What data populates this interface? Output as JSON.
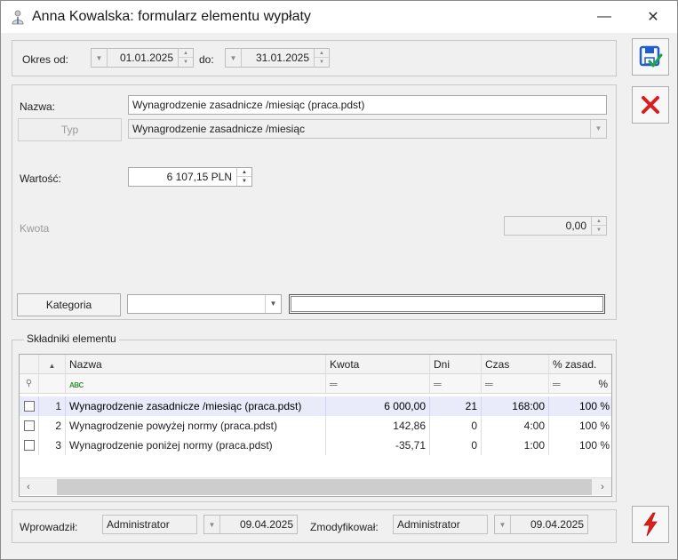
{
  "window": {
    "title": "Anna Kowalska: formularz elementu wypłaty",
    "minimize": "—",
    "close": "✕"
  },
  "period": {
    "from_label": "Okres od:",
    "from_value": "01.01.2025",
    "to_label": "do:",
    "to_value": "31.01.2025"
  },
  "element": {
    "name_label": "Nazwa:",
    "name_value": "Wynagrodzenie zasadnicze /miesiąc (praca.pdst)",
    "type_button": "Typ",
    "type_value": "Wynagrodzenie zasadnicze /miesiąc",
    "value_label": "Wartość:",
    "value_value": "6 107,15 PLN",
    "amount_label": "Kwota",
    "amount_value": "0,00",
    "category_button": "Kategoria",
    "category_value": "",
    "category_desc": ""
  },
  "components": {
    "group_title": "Składniki elementu",
    "columns": {
      "name": "Nazwa",
      "amount": "Kwota",
      "days": "Dni",
      "time": "Czas",
      "pct": "% zasad."
    },
    "filter": {
      "abc": "ABC",
      "eq": "═",
      "pct": "%"
    },
    "rows": [
      {
        "no": "1",
        "name": "Wynagrodzenie zasadnicze /miesiąc (praca.pdst)",
        "amount": "6 000,00",
        "days": "21",
        "time": "168:00",
        "pct": "100 %"
      },
      {
        "no": "2",
        "name": "Wynagrodzenie powyżej normy (praca.pdst)",
        "amount": "142,86",
        "days": "0",
        "time": "4:00",
        "pct": "100 %"
      },
      {
        "no": "3",
        "name": "Wynagrodzenie poniżej normy (praca.pdst)",
        "amount": "-35,71",
        "days": "0",
        "time": "1:00",
        "pct": "100 %"
      }
    ]
  },
  "footer": {
    "entered_label": "Wprowadził:",
    "entered_by": "Administrator",
    "entered_date": "09.04.2025",
    "modified_label": "Zmodyfikował:",
    "modified_by": "Administrator",
    "modified_date": "09.04.2025"
  },
  "colors": {
    "save_blue": "#1f5ec9",
    "save_check": "#1aa34a",
    "cancel_red": "#d42020",
    "lightning_red": "#e0201b"
  }
}
